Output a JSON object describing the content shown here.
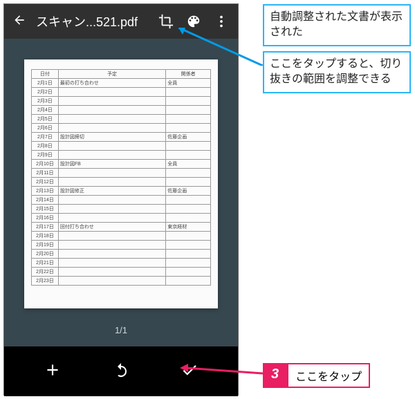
{
  "topbar": {
    "title": "スキャン...521.pdf"
  },
  "pager": "1/1",
  "annotations": {
    "a1": "自動調整された文書が表示された",
    "a2": "ここをタップすると、切り抜きの範囲を調整できる",
    "step": "3",
    "a3": "ここをタップ"
  },
  "doc": {
    "headers": {
      "date": "日付",
      "plan": "予定",
      "rel": "関係者"
    },
    "rows": [
      {
        "d": "2月1日",
        "p": "最初の打ち合わせ",
        "r": "全員"
      },
      {
        "d": "2月2日",
        "p": "",
        "r": ""
      },
      {
        "d": "2月3日",
        "p": "",
        "r": ""
      },
      {
        "d": "2月4日",
        "p": "",
        "r": ""
      },
      {
        "d": "2月5日",
        "p": "",
        "r": ""
      },
      {
        "d": "2月6日",
        "p": "",
        "r": ""
      },
      {
        "d": "2月7日",
        "p": "設計図締切",
        "r": "佐藤企画"
      },
      {
        "d": "2月8日",
        "p": "",
        "r": ""
      },
      {
        "d": "2月9日",
        "p": "",
        "r": ""
      },
      {
        "d": "2月10日",
        "p": "設計図FB",
        "r": "全員"
      },
      {
        "d": "2月11日",
        "p": "",
        "r": ""
      },
      {
        "d": "2月12日",
        "p": "",
        "r": ""
      },
      {
        "d": "2月13日",
        "p": "設計図修正",
        "r": "佐藤企画"
      },
      {
        "d": "2月14日",
        "p": "",
        "r": ""
      },
      {
        "d": "2月15日",
        "p": "",
        "r": ""
      },
      {
        "d": "2月16日",
        "p": "",
        "r": ""
      },
      {
        "d": "2月17日",
        "p": "回付打ち合わせ",
        "r": "東京経材"
      },
      {
        "d": "2月18日",
        "p": "",
        "r": ""
      },
      {
        "d": "2月19日",
        "p": "",
        "r": ""
      },
      {
        "d": "2月20日",
        "p": "",
        "r": ""
      },
      {
        "d": "2月21日",
        "p": "",
        "r": ""
      },
      {
        "d": "2月22日",
        "p": "",
        "r": ""
      },
      {
        "d": "2月23日",
        "p": "",
        "r": ""
      }
    ]
  }
}
